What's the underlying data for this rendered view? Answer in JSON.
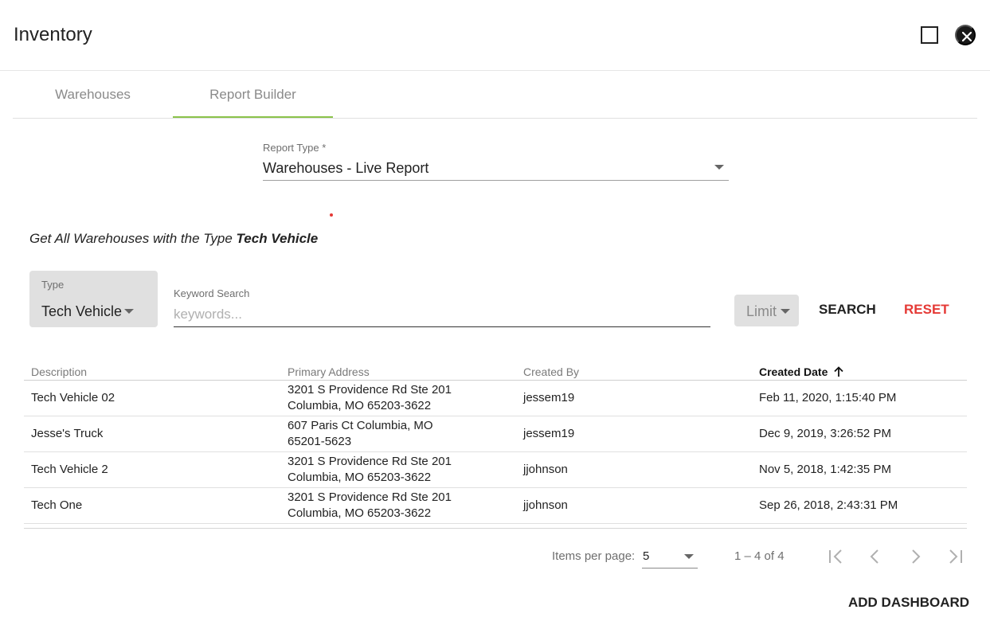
{
  "window": {
    "title": "Inventory",
    "maximize_icon": "square-outline-icon",
    "close_icon": "close-circle-icon"
  },
  "tabs": [
    {
      "label": "Warehouses",
      "active": false
    },
    {
      "label": "Report Builder",
      "active": true
    }
  ],
  "report_type": {
    "label": "Report Type *",
    "value": "Warehouses - Live Report"
  },
  "query_description": {
    "prefix": "Get All Warehouses with the Type ",
    "emphasis": "Tech Vehicle"
  },
  "filters": {
    "type": {
      "label": "Type",
      "value": "Tech Vehicle"
    },
    "keyword": {
      "label": "Keyword Search",
      "placeholder": "keywords..."
    },
    "limit": {
      "value": "Limit"
    },
    "search_label": "SEARCH",
    "reset_label": "RESET"
  },
  "table": {
    "columns": [
      "Description",
      "Primary Address",
      "Created By",
      "Created Date"
    ],
    "sorted_column": "Created Date",
    "sort_direction": "ascending",
    "rows": [
      {
        "description": "Tech Vehicle 02",
        "address_line1": "3201 S Providence Rd Ste 201",
        "address_line2": "Columbia, MO 65203-3622",
        "created_by": "jessem19",
        "created_date": "Feb 11, 2020, 1:15:40 PM"
      },
      {
        "description": "Jesse's Truck",
        "address_line1": "607 Paris Ct Columbia, MO",
        "address_line2": "65201-5623",
        "created_by": "jessem19",
        "created_date": "Dec 9, 2019, 3:26:52 PM"
      },
      {
        "description": "Tech Vehicle 2",
        "address_line1": "3201 S Providence Rd Ste 201",
        "address_line2": "Columbia, MO 65203-3622",
        "created_by": "jjohnson",
        "created_date": "Nov 5, 2018, 1:42:35 PM"
      },
      {
        "description": "Tech One",
        "address_line1": "3201 S Providence Rd Ste 201",
        "address_line2": "Columbia, MO 65203-3622",
        "created_by": "jjohnson",
        "created_date": "Sep 26, 2018, 2:43:31 PM"
      }
    ]
  },
  "paginator": {
    "items_per_page_label": "Items per page:",
    "items_per_page": "5",
    "range_label": "1 – 4 of 4"
  },
  "footer": {
    "add_dashboard_label": "ADD DASHBOARD"
  },
  "colors": {
    "active_tab_indicator": "#8bc34a",
    "reset": "#e53935"
  }
}
